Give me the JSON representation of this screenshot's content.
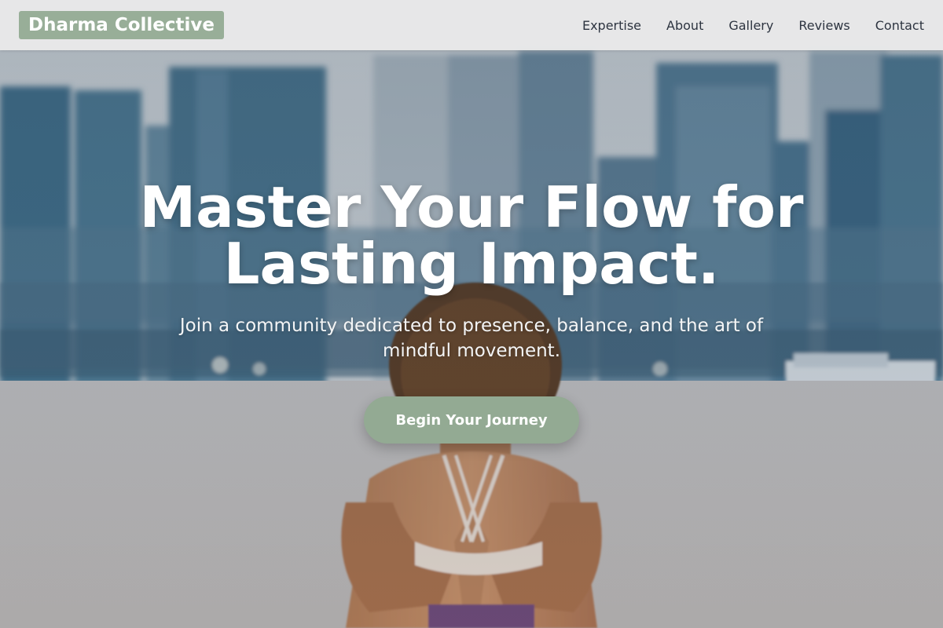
{
  "navbar": {
    "brand": "Dharma Collective",
    "links": [
      "Expertise",
      "About",
      "Gallery",
      "Reviews",
      "Contact"
    ]
  },
  "hero": {
    "title": "Master Your Flow for Lasting Impact.",
    "subtitle": "Join a community dedicated to presence, balance, and the art of mindful movement.",
    "cta_label": "Begin Your Journey",
    "background_image": "city-skyline-waterfront-yoga-woman-photo"
  },
  "colors": {
    "brand_bg": "#98ae98",
    "cta_bg": "#93aa93",
    "nav_text": "#2d3440",
    "hero_text": "#ffffff"
  }
}
